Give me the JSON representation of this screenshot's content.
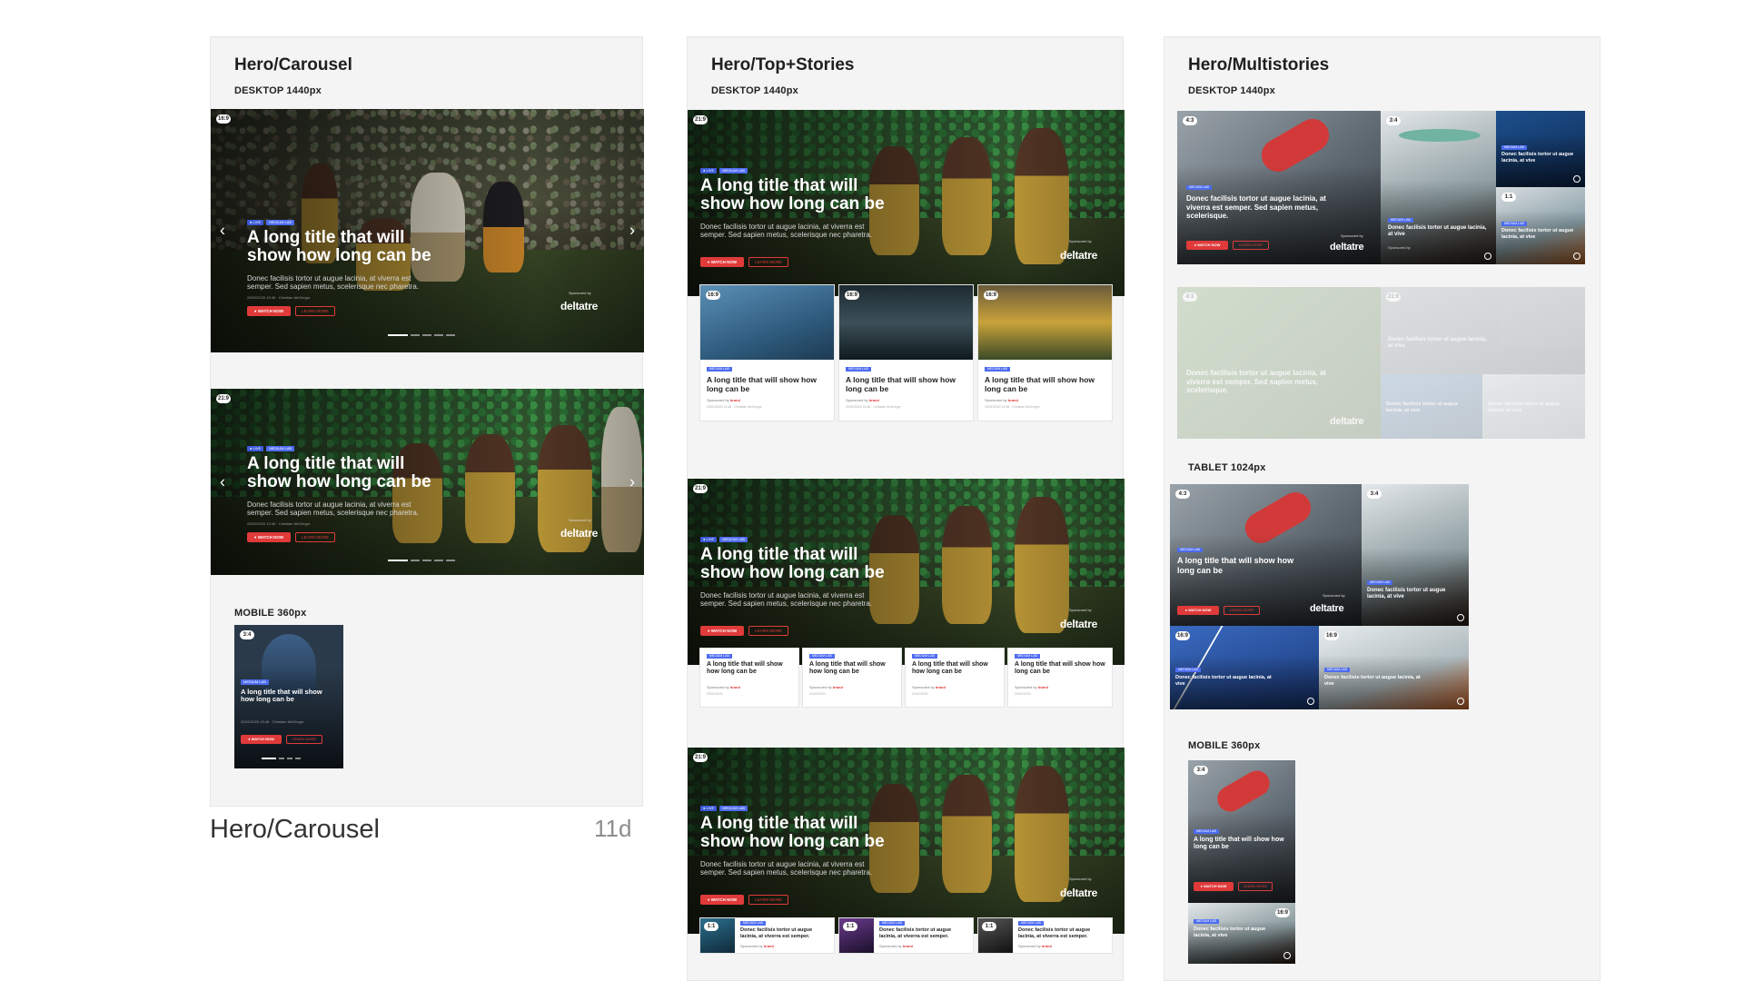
{
  "boards": [
    {
      "title": "Hero/Carousel"
    },
    {
      "title": "Hero/Top+Stories"
    },
    {
      "title": "Hero/Multistories"
    }
  ],
  "labels": {
    "desktop": "DESKTOP 1440px",
    "tablet": "TABLET 1024px",
    "mobile": "MOBILE 360px"
  },
  "hero": {
    "title_line1": "A long title that will",
    "title_line2": "show how long can be",
    "desc_line1": "Donec facilisis tortor ut augue lacinia, at viverra est",
    "desc_line2": "semper. Sed sapien metus, scelerisque nec pharetra.",
    "meta": "20/02/2020 13:46 · Christian McGregor",
    "chip_live": "● LIVE",
    "chip_cat": "MEDIUM LAB",
    "watch": "● WATCH NOW",
    "learn": "LEARN MORE",
    "sponsored": "Sponsored by",
    "brand": "deltatre",
    "arrow_left": "‹",
    "arrow_right": "›"
  },
  "ratios": {
    "r169": "16:9",
    "r219": "21:9",
    "r43": "4:3",
    "r34": "3:4",
    "r11": "1:1"
  },
  "story": {
    "title": "A long title that will show how long can be",
    "chip": "MEDIUM LAB",
    "sponsored": "Sponsored by",
    "sponsor_brand": "brand",
    "meta": "20/02/2020 13:46 · Christian McGregor",
    "short_title": "Donec facilisis tortor ut augue lacinia, at viverra est semper.",
    "multi_title": "Donec facilisis tortor ut augue lacinia, at vive",
    "multi_big": "Donec facilisis tortor ut augue lacinia, at viverra est semper. Sed sapien metus, scelerisque.",
    "date": "20/02/2020"
  },
  "mobile_card": {
    "title": "A long title that will show how long can be"
  },
  "footer": {
    "caption": "Hero/Carousel",
    "age": "11d"
  }
}
